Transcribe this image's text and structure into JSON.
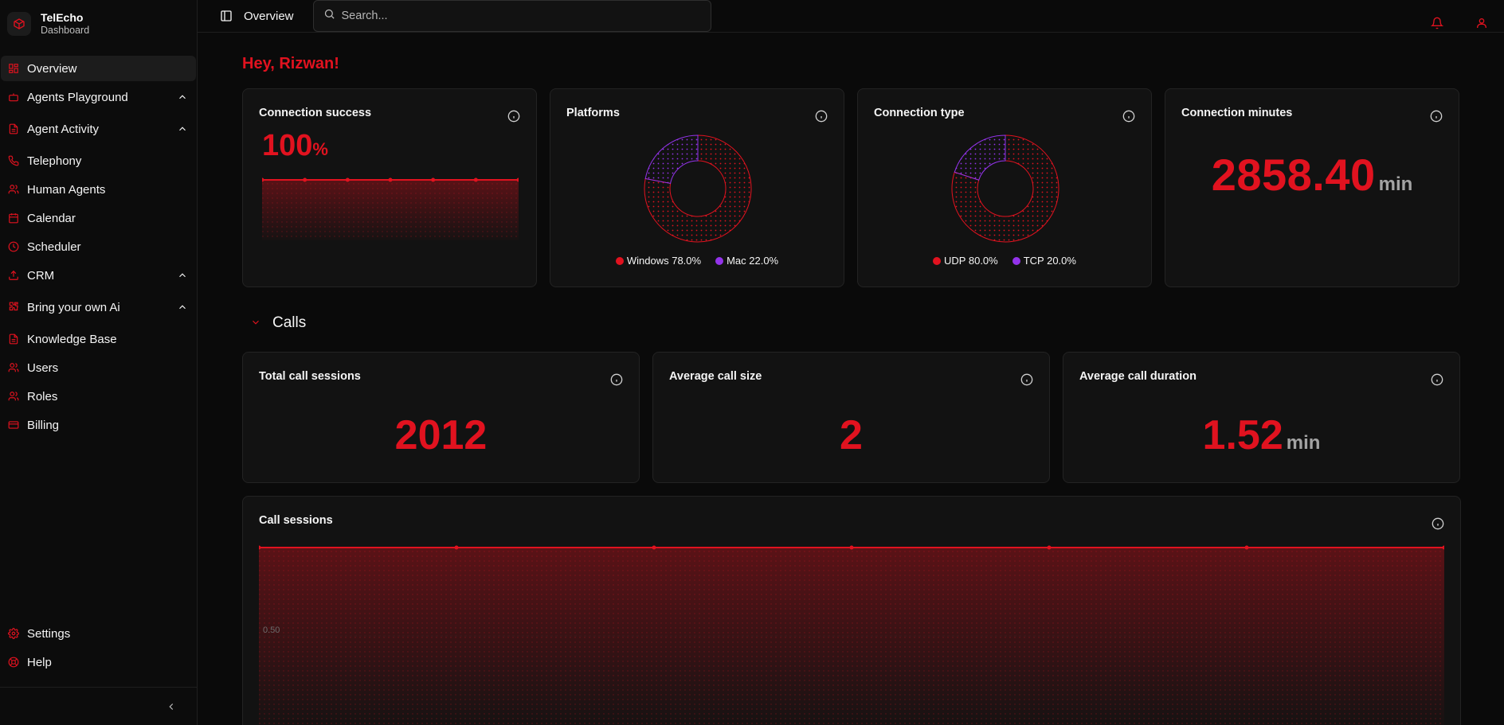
{
  "brand": {
    "title": "TelEcho",
    "subtitle": "Dashboard"
  },
  "sidebar": {
    "items": [
      {
        "label": "Overview",
        "icon": "grid-icon",
        "active": true
      },
      {
        "label": "Agents Playground",
        "icon": "bot-icon",
        "expandable": true
      },
      {
        "label": "Agent Activity",
        "icon": "file-icon",
        "expandable": true
      },
      {
        "label": "Telephony",
        "icon": "phone-icon"
      },
      {
        "label": "Human Agents",
        "icon": "users-icon"
      },
      {
        "label": "Calendar",
        "icon": "calendar-icon"
      },
      {
        "label": "Scheduler",
        "icon": "clock-icon"
      },
      {
        "label": "CRM",
        "icon": "upload-icon",
        "expandable": true
      },
      {
        "label": "Bring your own Ai",
        "icon": "puzzle-icon",
        "expandable": true
      },
      {
        "label": "Knowledge Base",
        "icon": "file-icon"
      },
      {
        "label": "Users",
        "icon": "users-icon"
      },
      {
        "label": "Roles",
        "icon": "users-icon"
      },
      {
        "label": "Billing",
        "icon": "card-icon"
      }
    ],
    "bottom_items": [
      {
        "label": "Settings",
        "icon": "gear-icon"
      },
      {
        "label": "Help",
        "icon": "lifebuoy-icon"
      }
    ]
  },
  "header": {
    "breadcrumb": "Overview",
    "search_placeholder": "Search..."
  },
  "greeting": "Hey, Rizwan!",
  "cards": {
    "connection_success": {
      "title": "Connection success",
      "value": "100",
      "unit": "%"
    },
    "platforms": {
      "title": "Platforms",
      "legend": [
        {
          "label": "Windows 78.0%",
          "color": "#e1121f"
        },
        {
          "label": "Mac 22.0%",
          "color": "#9333ea"
        }
      ]
    },
    "connection_type": {
      "title": "Connection type",
      "legend": [
        {
          "label": "UDP 80.0%",
          "color": "#e1121f"
        },
        {
          "label": "TCP 20.0%",
          "color": "#9333ea"
        }
      ]
    },
    "connection_minutes": {
      "title": "Connection minutes",
      "value": "2858.40",
      "unit": "min"
    }
  },
  "calls": {
    "heading": "Calls",
    "total_sessions": {
      "title": "Total call sessions",
      "value": "2012"
    },
    "avg_size": {
      "title": "Average call size",
      "value": "2"
    },
    "avg_duration": {
      "title": "Average call duration",
      "value": "1.52",
      "unit": "min"
    },
    "sessions_chart": {
      "title": "Call sessions",
      "tick_label": "0.50"
    }
  },
  "chart_data": [
    {
      "type": "area",
      "title": "Connection success",
      "series": [
        {
          "values": [
            100,
            100,
            100,
            100,
            100,
            100,
            100
          ]
        }
      ]
    },
    {
      "type": "pie",
      "title": "Platforms",
      "categories": [
        "Windows",
        "Mac"
      ],
      "values": [
        78.0,
        22.0
      ]
    },
    {
      "type": "pie",
      "title": "Connection type",
      "categories": [
        "UDP",
        "TCP"
      ],
      "values": [
        80.0,
        20.0
      ]
    },
    {
      "type": "area",
      "title": "Call sessions",
      "ylabel": "",
      "yticks": [
        "0.50"
      ],
      "series": [
        {
          "values": [
            1,
            1,
            1,
            1,
            1,
            1,
            1
          ]
        }
      ]
    }
  ],
  "colors": {
    "accent": "#e1121f",
    "secondary": "#9333ea",
    "background": "#0a0a0a",
    "card": "#121212"
  }
}
